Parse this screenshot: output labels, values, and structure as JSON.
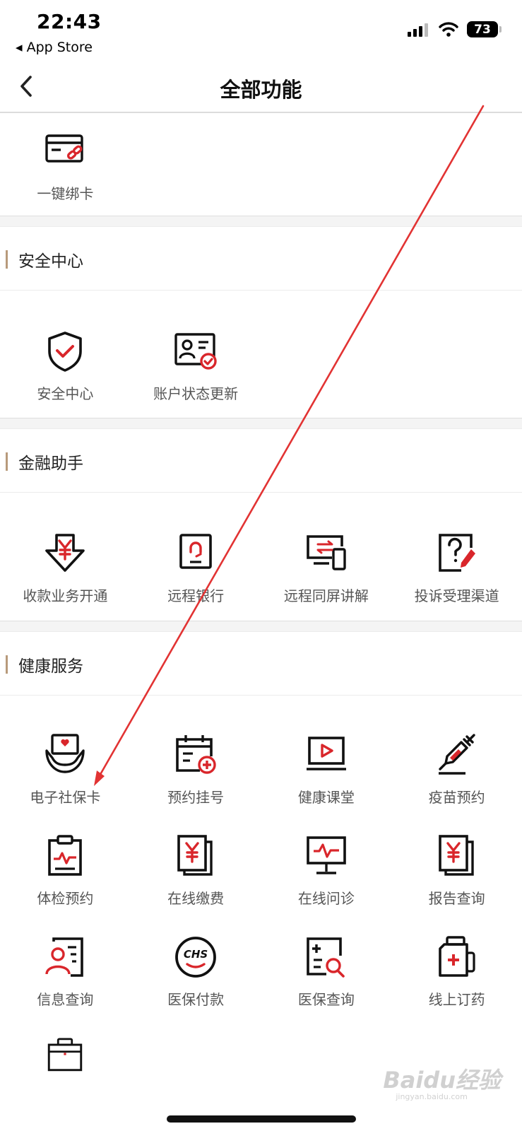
{
  "status_bar": {
    "time": "22:43",
    "back_app": "◂ App Store",
    "battery": "73"
  },
  "nav": {
    "title": "全部功能"
  },
  "top_items": [
    {
      "label": "一键绑卡",
      "icon": "card-link-icon"
    }
  ],
  "sections": [
    {
      "title": "安全中心",
      "items": [
        {
          "label": "安全中心",
          "icon": "shield-check-icon"
        },
        {
          "label": "账户状态更新",
          "icon": "id-card-check-icon"
        }
      ]
    },
    {
      "title": "金融助手",
      "items": [
        {
          "label": "收款业务开通",
          "icon": "yuan-download-icon"
        },
        {
          "label": "远程银行",
          "icon": "headset-icon"
        },
        {
          "label": "远程同屏讲解",
          "icon": "screen-share-icon"
        },
        {
          "label": "投诉受理渠道",
          "icon": "question-pen-icon"
        }
      ]
    },
    {
      "title": "健康服务",
      "items": [
        {
          "label": "电子社保卡",
          "icon": "social-security-card-icon"
        },
        {
          "label": "预约挂号",
          "icon": "calendar-plus-icon"
        },
        {
          "label": "健康课堂",
          "icon": "video-play-icon"
        },
        {
          "label": "疫苗预约",
          "icon": "syringe-icon"
        },
        {
          "label": "体检预约",
          "icon": "clipboard-pulse-icon"
        },
        {
          "label": "在线缴费",
          "icon": "yuan-document-icon"
        },
        {
          "label": "在线问诊",
          "icon": "monitor-pulse-icon"
        },
        {
          "label": "报告查询",
          "icon": "report-yuan-icon"
        },
        {
          "label": "信息查询",
          "icon": "person-info-icon"
        },
        {
          "label": "医保付款",
          "icon": "chs-badge-icon"
        },
        {
          "label": "医保查询",
          "icon": "medical-search-icon"
        },
        {
          "label": "线上订药",
          "icon": "medicine-bottle-icon"
        },
        {
          "label": "",
          "icon": "medical-kit-icon"
        }
      ]
    }
  ],
  "chs_text": "CHS",
  "watermark": {
    "brand": "Baidu经验",
    "site": "jingyan.baidu.com"
  },
  "colors": {
    "accent": "#d9262b",
    "section_bar": "#b89a7b",
    "gap": "#f4f4f4"
  }
}
